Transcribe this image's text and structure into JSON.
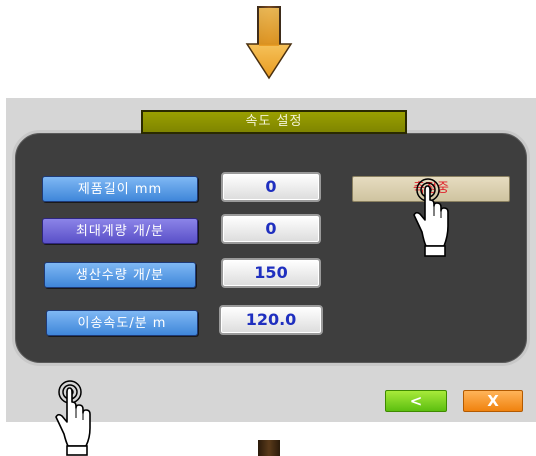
{
  "dialog": {
    "title": "속도 설정"
  },
  "fields": [
    {
      "label": "제품길이 mm",
      "value": "0"
    },
    {
      "label": "최대계량 개/분",
      "value": "0"
    },
    {
      "label": "생산수량 개/분",
      "value": "150"
    },
    {
      "label": "이송속도/분 m",
      "value": "120.0"
    }
  ],
  "measure_button": {
    "label": "측정중"
  },
  "nav": {
    "back_label": "<",
    "close_label": "X"
  },
  "colors": {
    "arrow_fill": "#f0a830",
    "dark_arrow": "#3a2a1a",
    "title_bar": "#8a9000",
    "panel_bg": "#3e3e3e",
    "screen_bg": "#d6d6d6",
    "value_text": "#1f2fbf",
    "measure_text": "#e0202a",
    "back_green": "#7ed321",
    "close_orange": "#f59a23"
  },
  "icons": [
    "down-arrow-icon",
    "pointing-hand-icon",
    "pointing-hand-icon",
    "down-arrow-icon",
    "chevron-left-icon",
    "close-icon"
  ]
}
